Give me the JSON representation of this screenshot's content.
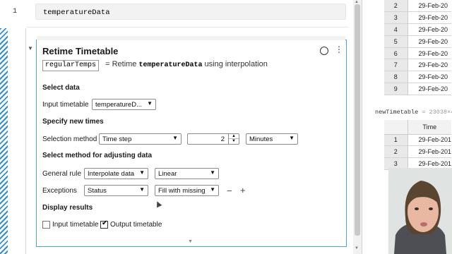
{
  "editor": {
    "line_number": "1",
    "code": "temperatureData"
  },
  "task": {
    "title": "Retime Timetable",
    "output_var": "regularTemps",
    "summary_eq": "=",
    "summary_text_pre": "Retime",
    "summary_input_var": "temperatureData",
    "summary_text_post": "using interpolation",
    "sections": {
      "select_data": "Select data",
      "specify_times": "Specify new times",
      "adjust_method": "Select method for adjusting data",
      "display": "Display results"
    },
    "labels": {
      "input_timetable": "Input timetable",
      "selection_method": "Selection method",
      "general_rule": "General rule",
      "exceptions": "Exceptions"
    },
    "controls": {
      "input_timetable_value": "temperatureD...",
      "selection_method_value": "Time step",
      "step_value": "2",
      "step_units": "Minutes",
      "general_rule_value": "Interpolate data",
      "general_method_value": "Linear",
      "exceptions_value": "Status",
      "exceptions_method_value": "Fill with missing",
      "minus": "−",
      "plus": "+"
    },
    "display": {
      "input_timetable_label": "Input timetable",
      "input_timetable_checked": false,
      "output_timetable_label": "Output timetable",
      "output_timetable_checked": true
    }
  },
  "workspace": {
    "table1_rows": [
      {
        "idx": "2",
        "value": "29-Feb-20"
      },
      {
        "idx": "3",
        "value": "29-Feb-20"
      },
      {
        "idx": "4",
        "value": "29-Feb-20"
      },
      {
        "idx": "5",
        "value": "29-Feb-20"
      },
      {
        "idx": "6",
        "value": "29-Feb-20"
      },
      {
        "idx": "7",
        "value": "29-Feb-20"
      },
      {
        "idx": "8",
        "value": "29-Feb-20"
      },
      {
        "idx": "9",
        "value": "29-Feb-20"
      }
    ],
    "table2_name": "newTimetable",
    "table2_size": "= 23038×4",
    "table2_header": "Time",
    "table2_rows": [
      {
        "idx": "1",
        "value": "29-Feb-201"
      },
      {
        "idx": "2",
        "value": "29-Feb-201"
      },
      {
        "idx": "3",
        "value": "29-Feb-201"
      }
    ]
  }
}
